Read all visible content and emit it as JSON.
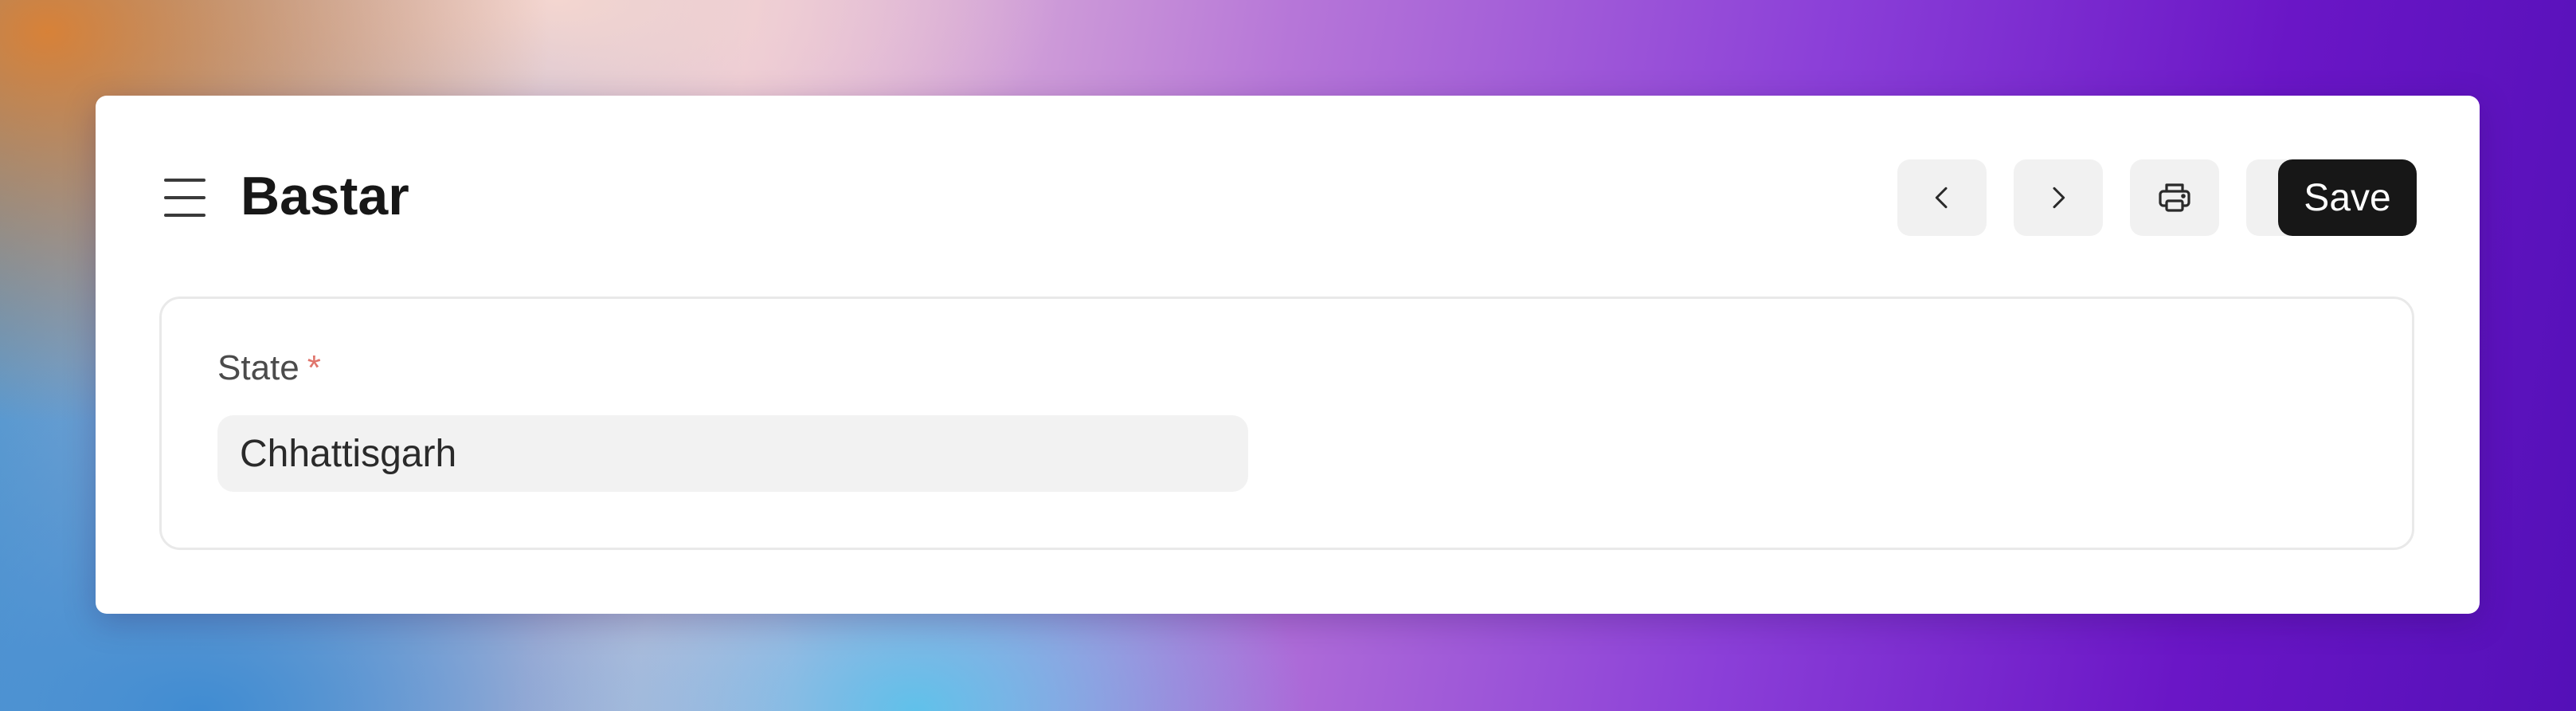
{
  "header": {
    "title": "Bastar",
    "actions": {
      "prev_icon": "chevron-left-icon",
      "next_icon": "chevron-right-icon",
      "print_icon": "printer-icon",
      "more_icon": "more-horizontal-icon",
      "save_label": "Save"
    }
  },
  "form": {
    "fields": [
      {
        "label": "State",
        "required_mark": "*",
        "value": "Chhattisgarh"
      }
    ]
  },
  "colors": {
    "primary_button": "#171717",
    "required_mark": "#e0756c",
    "icon_button_bg": "#f1f1f1",
    "input_bg": "#f2f2f2"
  }
}
